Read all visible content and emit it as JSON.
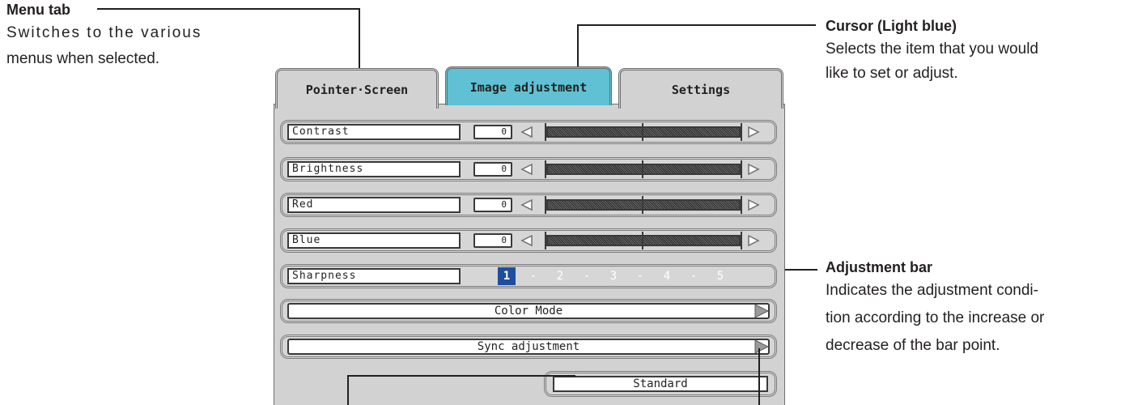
{
  "callouts": {
    "menu_tab": {
      "title": "Menu tab",
      "body": [
        "Switches to the various",
        "menus when selected."
      ]
    },
    "cursor": {
      "title": "Cursor (Light blue)",
      "body": [
        "Selects the item that you would",
        "like to set or adjust."
      ]
    },
    "adjustment_bar": {
      "title": "Adjustment bar",
      "body": [
        "Indicates the adjustment condi-",
        "tion according to the increase or",
        "decrease of the bar point."
      ]
    }
  },
  "tabs": [
    {
      "label": "Pointer·Screen",
      "active": false
    },
    {
      "label": "Image adjustment",
      "active": true
    },
    {
      "label": "Settings",
      "active": false
    }
  ],
  "rows": [
    {
      "label": "Contrast",
      "value": "0"
    },
    {
      "label": "Brightness",
      "value": "0"
    },
    {
      "label": "Red",
      "value": "0"
    },
    {
      "label": "Blue",
      "value": "0"
    }
  ],
  "sharpness": {
    "label": "Sharpness",
    "options": [
      "1",
      "2",
      "3",
      "4",
      "5"
    ],
    "selected": "1"
  },
  "color_mode": {
    "label": "Color Mode"
  },
  "sync": {
    "label": "Sync adjustment"
  },
  "standard": {
    "label": "Standard"
  },
  "colors": {
    "cursor": "#5fc1d3",
    "selected_number": "#1f4e9d",
    "panel": "#d2d2d2"
  }
}
